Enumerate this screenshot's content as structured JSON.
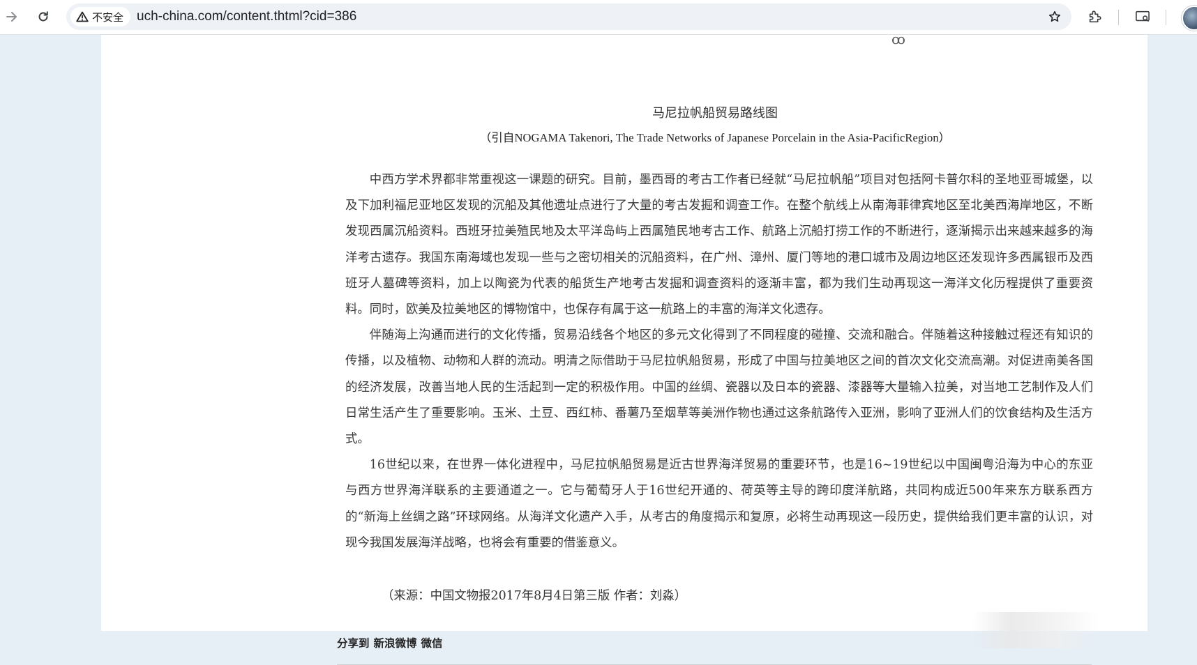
{
  "browser": {
    "security_label": "不安全",
    "url": "uch-china.com/content.thtml?cid=386",
    "icons": [
      "forward-icon",
      "reload-icon",
      "warning-icon",
      "star-icon",
      "extensions-icon",
      "cast-icon",
      "profile-avatar"
    ]
  },
  "article": {
    "figure_title": "马尼拉帆船贸易路线图",
    "figure_citation": "（引自NOGAMA Takenori, The Trade Networks of Japanese Porcelain in the Asia-PacificRegion）",
    "paragraphs": [
      "中西方学术界都非常重视这一课题的研究。目前，墨西哥的考古工作者已经就“马尼拉帆船”项目对包括阿卡普尔科的圣地亚哥城堡，以及下加利福尼亚地区发现的沉船及其他遗址点进行了大量的考古发掘和调查工作。在整个航线上从南海菲律宾地区至北美西海岸地区，不断发现西属沉船资料。西班牙拉美殖民地及太平洋岛屿上西属殖民地考古工作、航路上沉船打捞工作的不断进行，逐渐揭示出来越来越多的海洋考古遗存。我国东南海域也发现一些与之密切相关的沉船资料，在广州、漳州、厦门等地的港口城市及周边地区还发现许多西属银币及西班牙人墓碑等资料，加上以陶瓷为代表的船货生产地考古发掘和调查资料的逐渐丰富，都为我们生动再现这一海洋文化历程提供了重要资料。同时，欧美及拉美地区的博物馆中，也保存有属于这一航路上的丰富的海洋文化遗存。",
      "伴随海上沟通而进行的文化传播，贸易沿线各个地区的多元文化得到了不同程度的碰撞、交流和融合。伴随着这种接触过程还有知识的传播，以及植物、动物和人群的流动。明清之际借助于马尼拉帆船贸易，形成了中国与拉美地区之间的首次文化交流高潮。对促进南美各国的经济发展，改善当地人民的生活起到一定的积极作用。中国的丝绸、瓷器以及日本的瓷器、漆器等大量输入拉美，对当地工艺制作及人们日常生活产生了重要影响。玉米、土豆、西红柿、番薯乃至烟草等美洲作物也通过这条航路传入亚洲，影响了亚洲人们的饮食结构及生活方式。",
      "16世纪以来，在世界一体化进程中，马尼拉帆船贸易是近古世界海洋贸易的重要环节，也是16~19世纪以中国闽粤沿海为中心的东亚与西方世界海洋联系的主要通道之一。它与葡萄牙人于16世纪开通的、荷英等主导的跨印度洋航路，共同构成近500年来东方联系西方的“新海上丝绸之路”环球网络。从海洋文化遗产入手，从考古的角度揭示和复原，必将生动再现这一段历史，提供给我们更丰富的认识，对现今我国发展海洋战略，也将会有重要的借鉴意义。"
    ],
    "source": "（来源：中国文物报2017年8月4日第三版  作者：刘淼）"
  },
  "share": {
    "label": "分享到",
    "weibo": "新浪微博",
    "wechat": "微信"
  }
}
